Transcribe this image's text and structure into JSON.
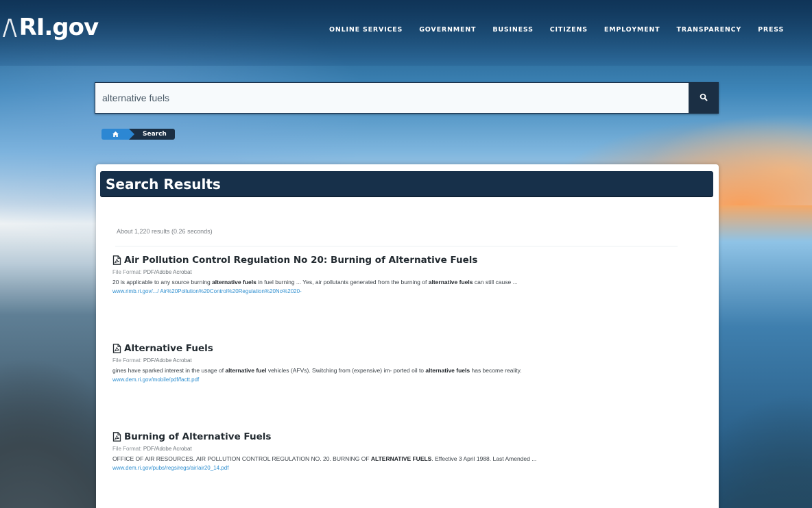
{
  "header": {
    "logo_mark": "/\\",
    "logo_text": "RI.gov",
    "nav": [
      "ONLINE SERVICES",
      "GOVERNMENT",
      "BUSINESS",
      "CITIZENS",
      "EMPLOYMENT",
      "TRANSPARENCY",
      "PRESS"
    ]
  },
  "search": {
    "value": "alternative fuels",
    "icon": "search-icon"
  },
  "breadcrumb": {
    "home_icon": "home-icon",
    "current": "Search"
  },
  "results": {
    "title": "Search Results",
    "count": "About 1,220 results (0.26 seconds)",
    "items": [
      {
        "title": "Air Pollution Control Regulation No 20: Burning of Alternative Fuels",
        "file_format_label": "File Format:",
        "file_format": "PDF/Adobe Acrobat",
        "snippet_1": "20 is applicable to any source burning ",
        "snippet_b1": "alternative fuels",
        "snippet_2": " in fuel burning ... Yes, air pollutants generated from the burning of ",
        "snippet_b2": "alternative fuels",
        "snippet_3": " can still cause ...",
        "url": "www.rimb.ri.gov/.../ Air%20Pollution%20Control%20Regulation%20No%2020-"
      },
      {
        "title": "Alternative Fuels",
        "file_format_label": "File Format:",
        "file_format": "PDF/Adobe Acrobat",
        "snippet_1": "gines have sparked interest in the usage of ",
        "snippet_b1": "alternative fuel",
        "snippet_2": " vehicles (AFVs). Switching from (expensive) im- ported oil to ",
        "snippet_b2": "alternative fuels",
        "snippet_3": " has become reality.",
        "url": "www.dem.ri.gov/mobile/pdf/factt.pdf"
      },
      {
        "title": "Burning of Alternative Fuels",
        "file_format_label": "File Format:",
        "file_format": "PDF/Adobe Acrobat",
        "snippet_1": "OFFICE OF AIR RESOURCES. AIR POLLUTION CONTROL REGULATION NO. 20. BURNING OF ",
        "snippet_b1": "ALTERNATIVE FUELS",
        "snippet_2": ". Effective 3 April 1988. Last Amended ...",
        "snippet_b2": "",
        "snippet_3": "",
        "url": "www.dem.ri.gov/pubs/regs/regs/air/air20_14.pdf"
      }
    ]
  },
  "colors": {
    "header_bar": "#17304a",
    "link": "#2f8fd0",
    "breadcrumb_home": "#2c87d3"
  }
}
